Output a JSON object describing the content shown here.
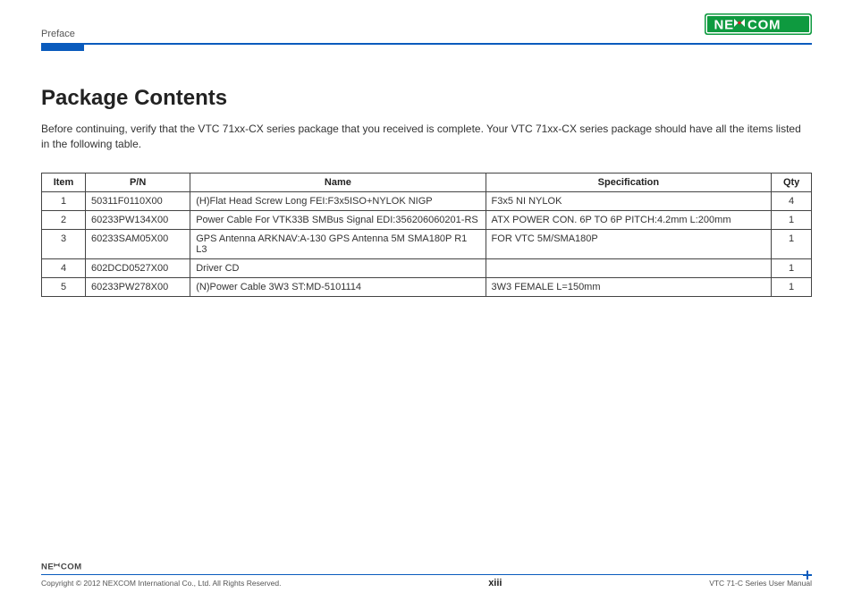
{
  "header": {
    "section": "Preface",
    "logo_text": "NEXCOM"
  },
  "title": "Package Contents",
  "intro": "Before continuing, verify that the VTC 71xx-CX series package that you received is complete. Your VTC 71xx-CX series package should have all the items listed in the following table.",
  "table": {
    "headers": {
      "item": "Item",
      "pn": "P/N",
      "name": "Name",
      "spec": "Specification",
      "qty": "Qty"
    },
    "rows": [
      {
        "item": "1",
        "pn": "50311F0110X00",
        "name": "(H)Flat Head Screw Long FEI:F3x5ISO+NYLOK NIGP",
        "spec": "F3x5 NI NYLOK",
        "qty": "4"
      },
      {
        "item": "2",
        "pn": "60233PW134X00",
        "name": "Power Cable For VTK33B SMBus Signal EDI:356206060201-RS",
        "spec": "ATX POWER CON. 6P TO 6P PITCH:4.2mm L:200mm",
        "qty": "1"
      },
      {
        "item": "3",
        "pn": "60233SAM05X00",
        "name": "GPS Antenna ARKNAV:A-130 GPS Antenna 5M SMA180P R1 L3",
        "spec": "FOR VTC 5M/SMA180P",
        "qty": "1"
      },
      {
        "item": "4",
        "pn": "602DCD0527X00",
        "name": "Driver CD",
        "spec": "",
        "qty": "1"
      },
      {
        "item": "5",
        "pn": "60233PW278X00",
        "name": "(N)Power Cable 3W3 ST:MD-5101114",
        "spec": "3W3 FEMALE L=150mm",
        "qty": "1"
      }
    ]
  },
  "footer": {
    "copyright": "Copyright © 2012 NEXCOM International Co., Ltd. All Rights Reserved.",
    "page_num": "xiii",
    "doc_title": "VTC 71-C Series User Manual"
  }
}
